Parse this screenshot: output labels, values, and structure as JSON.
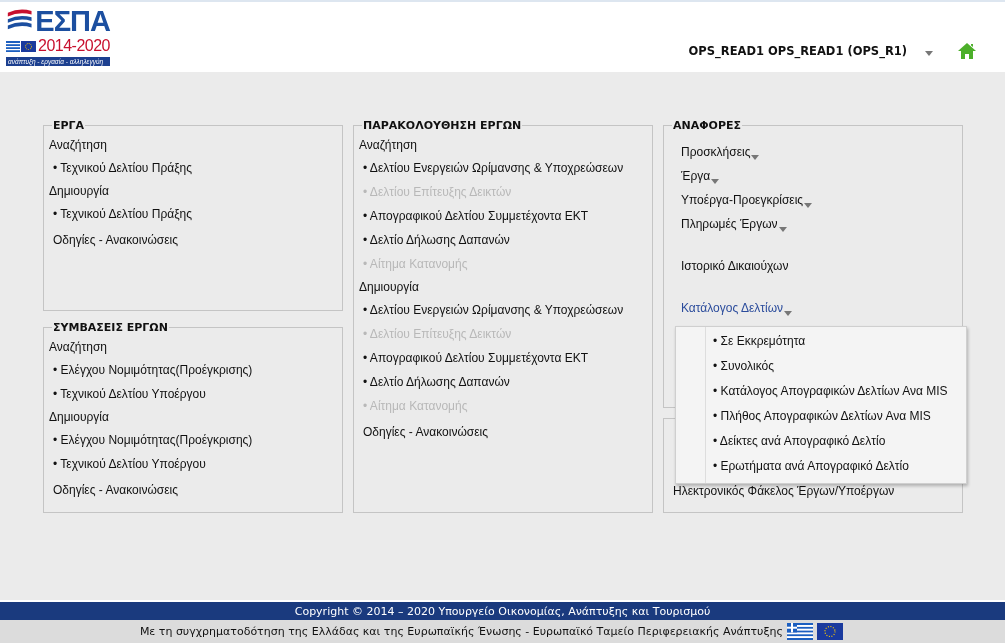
{
  "logo": {
    "title": "ΕΣΠΑ",
    "years": "2014-2020",
    "slogan": "ανάπτυξη - εργασία - αλληλεγγύη"
  },
  "user": {
    "name": "OPS_READ1 OPS_READ1 (OPS_R1)"
  },
  "columns": [
    {
      "panels": [
        {
          "title": "ΕΡΓΑ",
          "items": [
            {
              "kind": "heading",
              "text": "Αναζήτηση"
            },
            {
              "kind": "link",
              "text": "• Τεχνικού Δελτίου Πράξης",
              "disabled": false
            },
            {
              "kind": "heading",
              "text": "Δημιουργία"
            },
            {
              "kind": "link",
              "text": "• Τεχνικού Δελτίου Πράξης",
              "disabled": false
            },
            {
              "kind": "plain",
              "text": "Οδηγίες - Ανακοινώσεις"
            }
          ]
        },
        {
          "title": "ΣΥΜΒΑΣΕΙΣ ΕΡΓΩΝ",
          "items": [
            {
              "kind": "heading",
              "text": "Αναζήτηση"
            },
            {
              "kind": "link",
              "text": "• Ελέγχου Νομιμότητας(Προέγκρισης)",
              "disabled": false
            },
            {
              "kind": "link",
              "text": "• Τεχνικού Δελτίου Υποέργου",
              "disabled": false
            },
            {
              "kind": "heading",
              "text": "Δημιουργία"
            },
            {
              "kind": "link",
              "text": "• Ελέγχου Νομιμότητας(Προέγκρισης)",
              "disabled": false
            },
            {
              "kind": "link",
              "text": "• Τεχνικού Δελτίου Υποέργου",
              "disabled": false
            },
            {
              "kind": "plain",
              "text": "Οδηγίες - Ανακοινώσεις"
            }
          ]
        }
      ]
    },
    {
      "panels": [
        {
          "title": "ΠΑΡΑΚΟΛΟΥΘΗΣΗ ΕΡΓΩΝ",
          "items": [
            {
              "kind": "heading",
              "text": "Αναζήτηση"
            },
            {
              "kind": "link",
              "text": "• Δελτίου Ενεργειών Ωρίμανσης & Υποχρεώσεων",
              "disabled": false
            },
            {
              "kind": "link",
              "text": "• Δελτίου Επίτευξης Δεικτών",
              "disabled": true
            },
            {
              "kind": "link",
              "text": "• Απογραφικού Δελτίου Συμμετέχοντα ΕΚΤ",
              "disabled": false
            },
            {
              "kind": "link",
              "text": "• Δελτίο Δήλωσης Δαπανών",
              "disabled": false
            },
            {
              "kind": "link",
              "text": "• Αίτημα Κατανομής",
              "disabled": true
            },
            {
              "kind": "heading",
              "text": "Δημιουργία"
            },
            {
              "kind": "link",
              "text": "• Δελτίου Ενεργειών Ωρίμανσης & Υποχρεώσεων",
              "disabled": false
            },
            {
              "kind": "link",
              "text": "• Δελτίου Επίτευξης Δεικτών",
              "disabled": true
            },
            {
              "kind": "link",
              "text": "• Απογραφικού Δελτίου Συμμετέχοντα ΕΚΤ",
              "disabled": false
            },
            {
              "kind": "link",
              "text": "• Δελτίο Δήλωσης Δαπανών",
              "disabled": false
            },
            {
              "kind": "link",
              "text": "• Αίτημα Κατανομής",
              "disabled": true
            },
            {
              "kind": "plain",
              "text": "Οδηγίες - Ανακοινώσεις"
            }
          ]
        }
      ]
    },
    {
      "panels": [
        {
          "title": "ΑΝΑΦΟΡΕΣ",
          "groups": [
            [
              {
                "text": "Προσκλήσεις",
                "has_menu": true,
                "expanded": false
              },
              {
                "text": "Έργα",
                "has_menu": true,
                "expanded": false
              },
              {
                "text": "Υποέργα-Προεγκρίσεις",
                "has_menu": true,
                "expanded": false
              },
              {
                "text": "Πληρωμές Έργων",
                "has_menu": true,
                "expanded": false
              }
            ],
            [
              {
                "text": "Ιστορικό Δικαιούχων",
                "has_menu": false,
                "expanded": false
              }
            ],
            [
              {
                "text": "Κατάλογος Δελτίων",
                "has_menu": true,
                "expanded": true
              }
            ]
          ]
        },
        {
          "groups": [
            [
              {
                "text": "Ηλεκτρονικός Φάκελος Έργων/Υποέργων",
                "has_menu": false,
                "expanded": false
              }
            ]
          ]
        }
      ]
    }
  ],
  "dropdown": {
    "items": [
      "• Σε Εκκρεμότητα",
      "• Συνολικός",
      "• Κατάλογος Απογραφικών Δελτίων Ανα MIS",
      "• Πλήθος Απογραφικών Δελτίων Ανα MIS",
      "• Δείκτες ανά Απογραφικό Δελτίο",
      "• Ερωτήματα ανά Απογραφικό Δελτίο"
    ]
  },
  "footer": {
    "copyright": "Copyright © 2014 – 2020 Υπουργείο Οικονομίας, Ανάπτυξης και Τουρισμού",
    "cofunding": "Με τη συγχρηματοδότηση της Ελλάδας και της Ευρωπαϊκής Ένωσης - Ευρωπαϊκό Ταμείο Περιφερειακής Ανάπτυξης"
  }
}
